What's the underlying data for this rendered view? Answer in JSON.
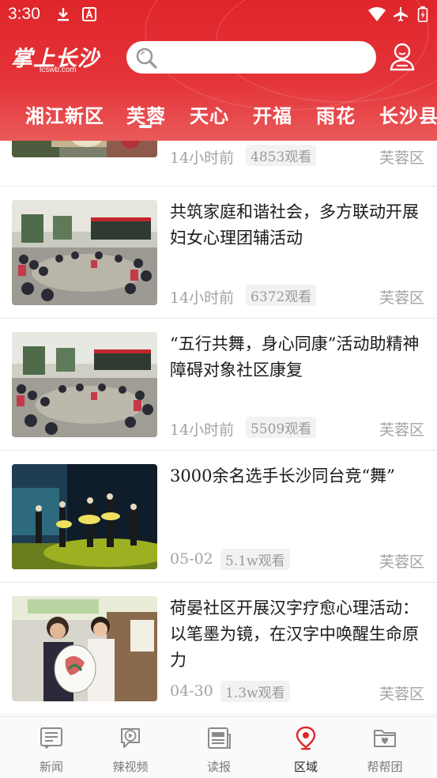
{
  "status_bar": {
    "time": "3:30"
  },
  "header": {
    "logo_text": "掌上长沙",
    "logo_domain": "lcswb.com",
    "search_placeholder": ""
  },
  "tabs": [
    "湘江新区",
    "芙蓉",
    "天心",
    "开福",
    "雨花",
    "长沙县"
  ],
  "active_tab": "芙蓉",
  "items": [
    {
      "title": "",
      "time": "14小时前",
      "views": "4853观看",
      "region": "芙蓉区"
    },
    {
      "title": "共筑家庭和谐社会，多方联动开展妇女心理团辅活动",
      "time": "14小时前",
      "views": "6372观看",
      "region": "芙蓉区"
    },
    {
      "title": "“五行共舞，身心同康”活动助精神障碍对象社区康复",
      "time": "14小时前",
      "views": "5509观看",
      "region": "芙蓉区"
    },
    {
      "title": "3000余名选手长沙同台竞“舞”",
      "time": "05-02",
      "views": "5.1w观看",
      "region": "芙蓉区"
    },
    {
      "title": "荷晏社区开展汉字疗愈心理活动：以笔墨为镜，在汉字中唤醒生命原力",
      "time": "04-30",
      "views": "1.3w观看",
      "region": "芙蓉区"
    }
  ],
  "bottom_nav": [
    {
      "label": "新闻",
      "icon": "news-icon"
    },
    {
      "label": "辣视频",
      "icon": "video-icon"
    },
    {
      "label": "读报",
      "icon": "newspaper-icon"
    },
    {
      "label": "区域",
      "icon": "location-icon"
    },
    {
      "label": "帮帮团",
      "icon": "folder-heart-icon"
    }
  ],
  "colors": {
    "brand_red": "#e0252a",
    "active_nav": "#e0252a",
    "muted": "#a3a3a3"
  }
}
